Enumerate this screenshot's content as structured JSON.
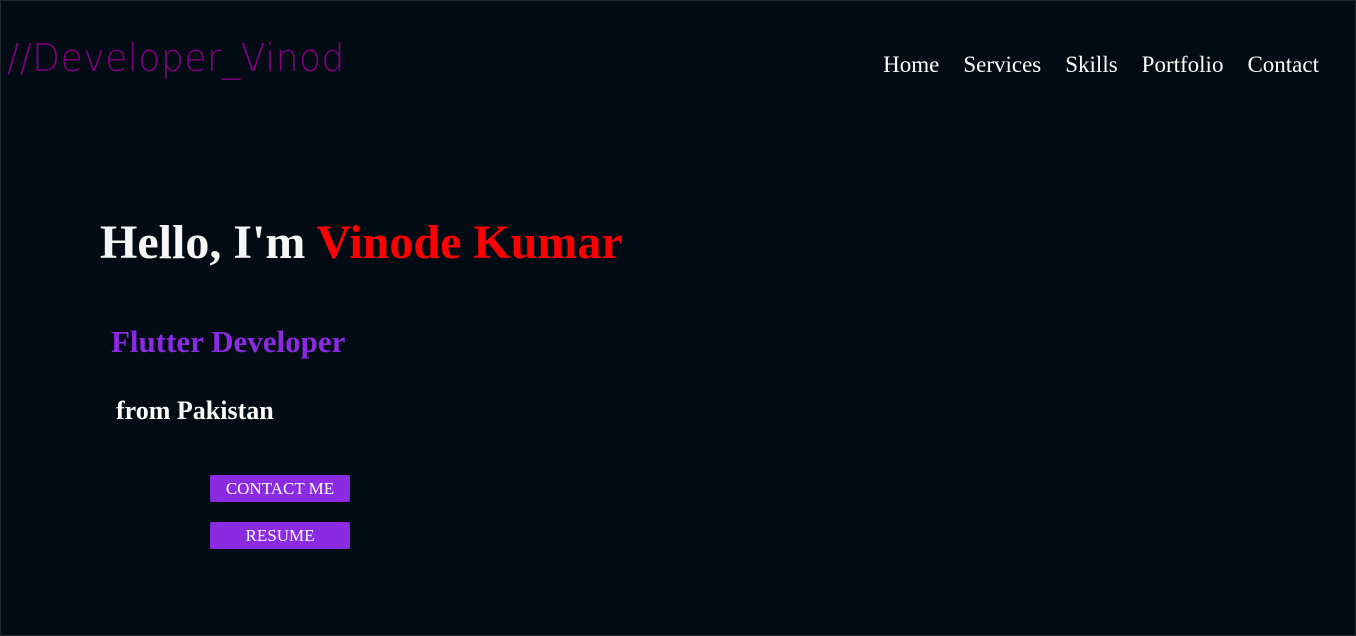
{
  "header": {
    "logo_text": "//Developer_Vinod",
    "nav": [
      {
        "label": "Home"
      },
      {
        "label": "Services"
      },
      {
        "label": "Skills"
      },
      {
        "label": "Portfolio"
      },
      {
        "label": "Contact"
      }
    ]
  },
  "hero": {
    "greeting": "Hello, I'm ",
    "name": "Vinode Kumar",
    "role": "Flutter Developer",
    "origin": "from Pakistan",
    "contact_button": "CONTACT ME",
    "resume_button": "RESUME"
  },
  "colors": {
    "background": "#030c14",
    "logo": "#800080",
    "name_accent": "#ff0000",
    "role": "#8a2be2",
    "button": "#8a2be2",
    "text": "#ffffff"
  }
}
